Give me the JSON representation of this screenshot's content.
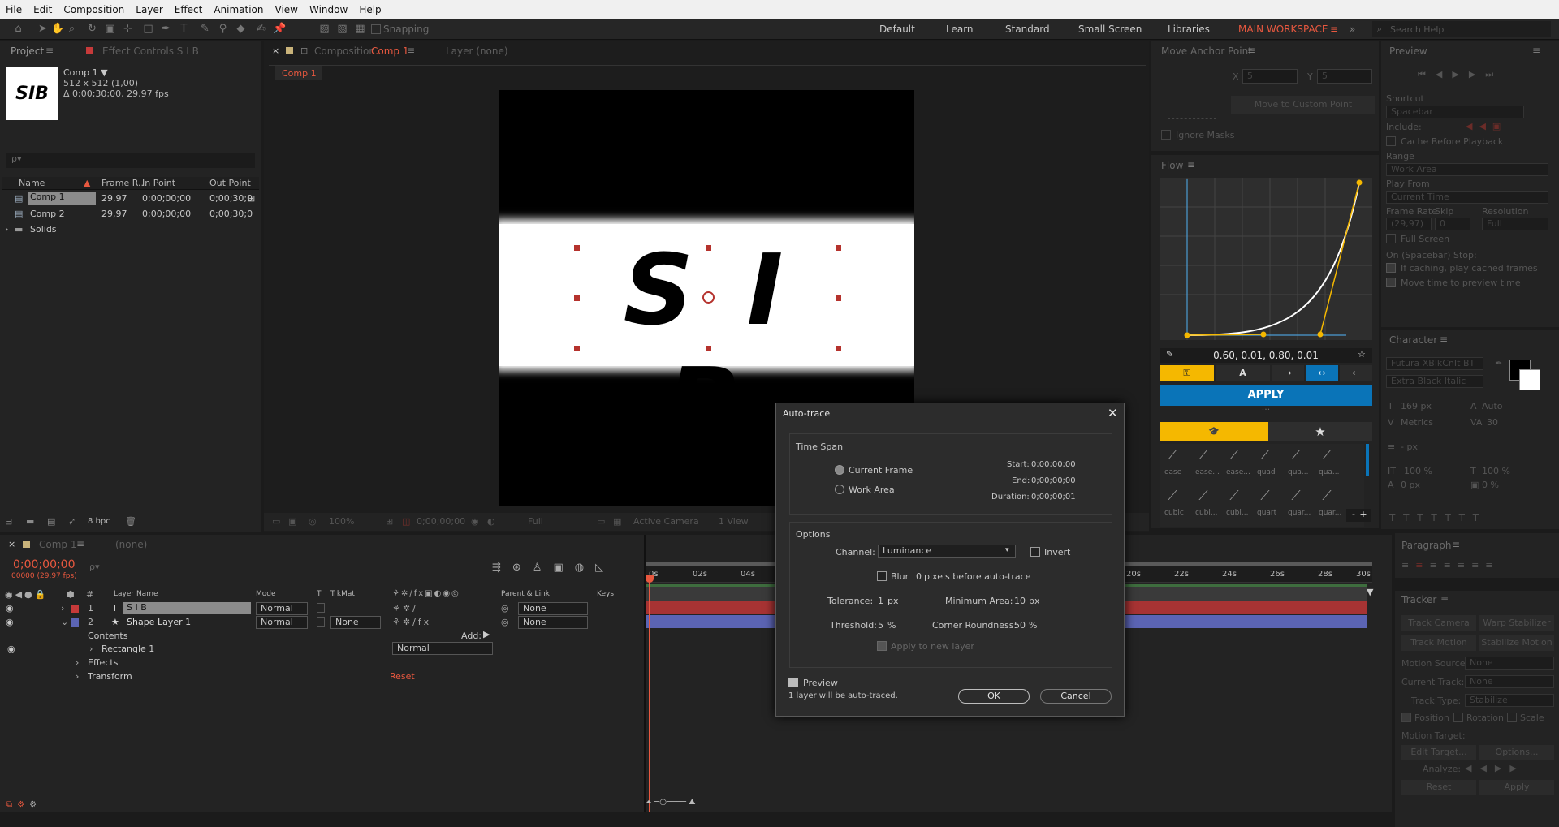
{
  "menu": [
    "File",
    "Edit",
    "Composition",
    "Layer",
    "Effect",
    "Animation",
    "View",
    "Window",
    "Help"
  ],
  "toolbar": {
    "snapping": "Snapping",
    "workspaces": [
      "Default",
      "Learn",
      "Standard",
      "Small Screen",
      "Libraries"
    ],
    "active_workspace": "MAIN WORKSPACE",
    "search_placeholder": "Search Help"
  },
  "project": {
    "tab": "Project",
    "effect_controls_tab": "Effect Controls S I B",
    "comp_name": "Comp 1 ▼",
    "comp_info1": "512 x 512 (1,00)",
    "comp_info2": "Δ 0;00;30;00, 29,97 fps",
    "thumb_text": "SIB",
    "search_placeholder": "ρ▾",
    "columns": [
      "Name",
      "Frame R...",
      "In Point",
      "Out Point"
    ],
    "items": [
      {
        "name": "Comp 1",
        "fr": "29,97",
        "in": "0;00;00;00",
        "out": "0;00;30;0"
      },
      {
        "name": "Comp 2",
        "fr": "29,97",
        "in": "0;00;00;00",
        "out": "0;00;30;0"
      },
      {
        "name": "Solids",
        "fr": "",
        "in": "",
        "out": ""
      }
    ],
    "bpc": "8 bpc"
  },
  "composition": {
    "tab": "Composition",
    "tab_comp": "Comp 1",
    "layer_tab": "Layer (none)",
    "breadcrumb": "Comp 1",
    "canvas_text": "S I B",
    "footer": {
      "zoom": "100%",
      "time": "0;00;00;00",
      "res": "Full",
      "camera": "Active Camera",
      "view": "1 View"
    }
  },
  "dialog": {
    "title": "Auto-trace",
    "time_span": "Time Span",
    "current_frame": "Current Frame",
    "work_area": "Work Area",
    "start_label": "Start:",
    "start_val": "0;00;00;00",
    "end_label": "End:",
    "end_val": "0;00;00;00",
    "dur_label": "Duration:",
    "dur_val": "0;00;00;01",
    "options": "Options",
    "channel_label": "Channel:",
    "channel_val": "Luminance",
    "invert": "Invert",
    "blur": "Blur",
    "blur_val": "0",
    "blur_suffix": "pixels before auto-trace",
    "tolerance_label": "Tolerance:",
    "tolerance_val": "1",
    "tolerance_unit": "px",
    "min_area_label": "Minimum Area:",
    "min_area_val": "10",
    "min_area_unit": "px",
    "threshold_label": "Threshold:",
    "threshold_val": "5",
    "threshold_unit": "%",
    "corner_label": "Corner Roundness:",
    "corner_val": "50",
    "corner_unit": "%",
    "apply_new": "Apply to new layer",
    "preview": "Preview",
    "status": "1 layer will be auto-traced.",
    "ok": "OK",
    "cancel": "Cancel"
  },
  "anchor": {
    "title": "Move Anchor Point",
    "x_label": "X",
    "x_val": "5",
    "y_label": "Y",
    "y_val": "5",
    "move_btn": "Move to Custom Point",
    "ignore_masks": "Ignore Masks"
  },
  "flow": {
    "title": "Flow",
    "values": "0.60, 0.01, 0.80, 0.01",
    "apply": "APPLY",
    "presets": [
      "ease",
      "ease...",
      "ease...",
      "quad",
      "qua...",
      "qua...",
      "cubic",
      "cubi...",
      "cubi...",
      "quart",
      "quar...",
      "quar..."
    ],
    "minus": "-",
    "plus": "+"
  },
  "preview": {
    "title": "Preview",
    "shortcut_label": "Shortcut",
    "shortcut_val": "Spacebar",
    "include": "Include:",
    "cache": "Cache Before Playback",
    "range_label": "Range",
    "range_val": "Work Area",
    "playfrom_label": "Play From",
    "playfrom_val": "Current Time",
    "fr_label": "Frame Rate",
    "skip_label": "Skip",
    "res_label": "Resolution",
    "fr_val": "(29,97)",
    "skip_val": "0",
    "res_val": "Full",
    "fullscreen": "Full Screen",
    "stop_label": "On (Spacebar) Stop:",
    "if_caching": "If caching, play cached frames",
    "move_time": "Move time to preview time"
  },
  "character": {
    "title": "Character",
    "font": "Futura XBlkCnIt BT",
    "style": "Extra Black Italic",
    "size": "169 px",
    "leading": "Auto",
    "kerning": "Metrics",
    "tracking": "30",
    "stroke": "- px",
    "vscale": "100 %",
    "hscale": "100 %",
    "baseline": "0 px",
    "tsume": "0 %"
  },
  "paragraph": {
    "title": "Paragraph"
  },
  "tracker": {
    "title": "Tracker",
    "track_camera": "Track Camera",
    "warp": "Warp Stabilizer",
    "track_motion": "Track Motion",
    "stabilize_motion": "Stabilize Motion",
    "motion_source_label": "Motion Source:",
    "motion_source_val": "None",
    "current_track_label": "Current Track:",
    "current_track_val": "None",
    "track_type_label": "Track Type:",
    "track_type_val": "Stabilize",
    "position": "Position",
    "rotation": "Rotation",
    "scale": "Scale",
    "motion_target": "Motion Target:",
    "edit_target": "Edit Target...",
    "options": "Options...",
    "analyze": "Analyze:",
    "reset": "Reset",
    "apply": "Apply"
  },
  "timeline": {
    "tab": "Comp 1",
    "render_queue": "(none)",
    "time": "0;00;00;00",
    "fps": "00000 (29.97 fps)",
    "search_placeholder": "ρ▾",
    "columns": {
      "layer_name": "Layer Name",
      "mode": "Mode",
      "t": "T",
      "trkmat": "TrkMat",
      "parent": "Parent & Link",
      "keys": "Keys"
    },
    "layers": [
      {
        "num": "1",
        "name": "S I B",
        "mode": "Normal",
        "trkmat": "",
        "parent": "None"
      },
      {
        "num": "2",
        "name": "Shape Layer 1",
        "mode": "Normal",
        "trkmat": "None",
        "parent": "None"
      }
    ],
    "contents": "Contents",
    "add": "Add:",
    "rectangle": "Rectangle 1",
    "rect_mode": "Normal",
    "effects": "Effects",
    "transform": "Transform",
    "reset": "Reset",
    "ruler": [
      "0s",
      "02s",
      "04s",
      "20s",
      "22s",
      "24s",
      "26s",
      "28s",
      "30s"
    ]
  },
  "colors": {
    "accent": "#e8583f",
    "flow_yellow": "#f5b800",
    "flow_blue": "#0a74b8",
    "layer_red": "#c63a3a",
    "layer_blue": "#5b64b4"
  }
}
